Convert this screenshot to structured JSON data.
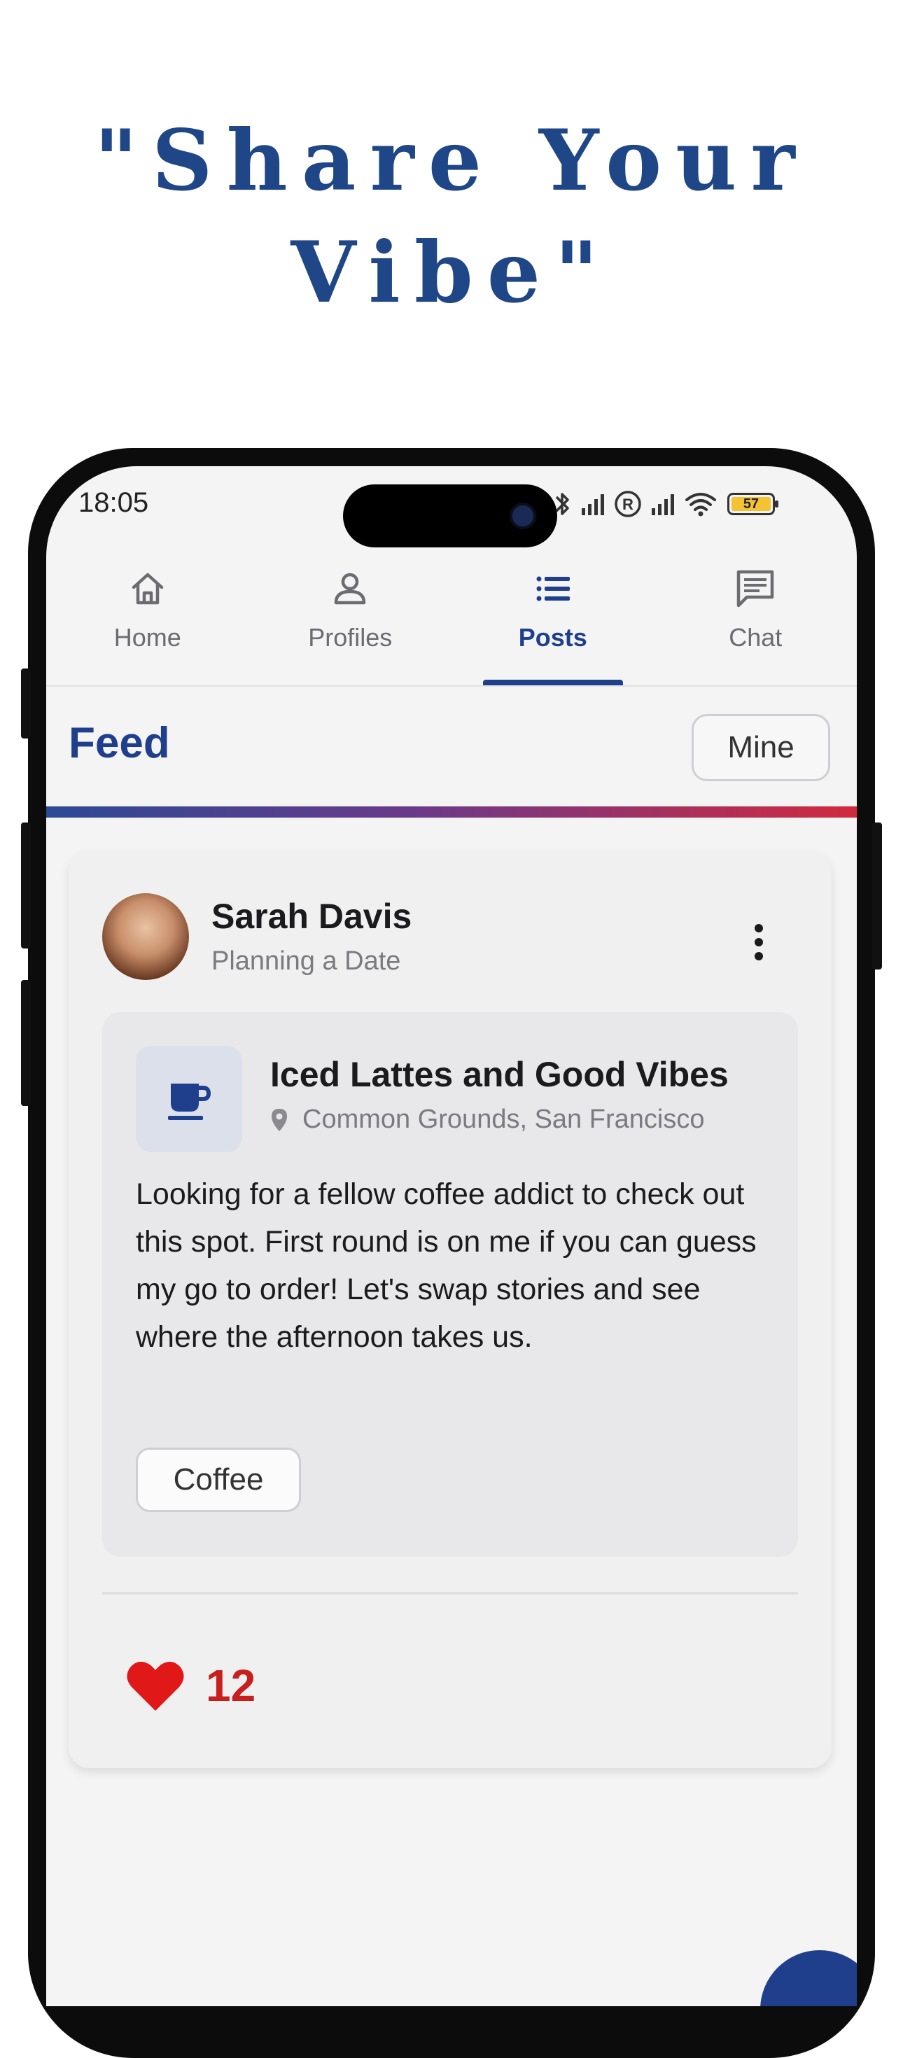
{
  "headline": {
    "line1": "\"Share Your",
    "line2": "Vibe\""
  },
  "status_bar": {
    "time": "18:05",
    "battery": "57"
  },
  "tabs": [
    {
      "label": "Home",
      "icon": "home-icon",
      "active": false
    },
    {
      "label": "Profiles",
      "icon": "person-icon",
      "active": false
    },
    {
      "label": "Posts",
      "icon": "list-icon",
      "active": true
    },
    {
      "label": "Chat",
      "icon": "chat-icon",
      "active": false
    }
  ],
  "feed": {
    "title": "Feed",
    "filter_label": "Mine"
  },
  "post": {
    "author": "Sarah Davis",
    "subtitle": "Planning a Date",
    "venue_title": "Iced Lattes and Good Vibes",
    "location": "Common Grounds, San Francisco",
    "body": "Looking for a fellow coffee addict to check out this spot. First round is on me if you can guess my go to order! Let's swap stories and see where the afternoon takes us.",
    "tag": "Coffee",
    "likes": "12",
    "icons": {
      "menu": "more-vertical-icon",
      "venue": "coffee-cup-icon",
      "location": "location-pin-icon",
      "like": "heart-icon"
    }
  },
  "colors": {
    "brand": "#1f3f8c",
    "headline": "#1f4788",
    "like": "#c81e1e",
    "gradient_end": "#d12a3e"
  }
}
